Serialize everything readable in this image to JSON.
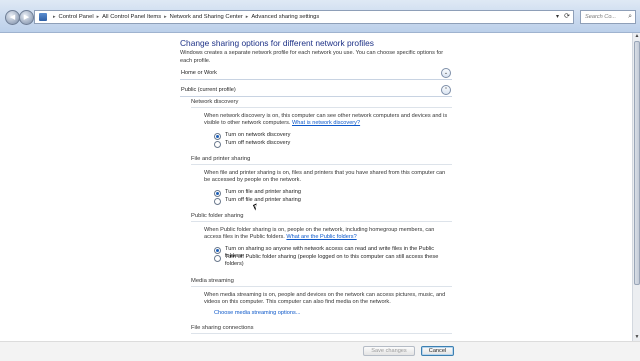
{
  "address_bar": {
    "breadcrumbs": [
      "Control Panel",
      "All Control Panel Items",
      "Network and Sharing Center",
      "Advanced sharing settings"
    ],
    "search_placeholder": "Search Co..."
  },
  "heading": "Change sharing options for different network profiles",
  "intro": "Windows creates a separate network profile for each network you use. You can choose specific options for each profile.",
  "profiles": {
    "home": {
      "label": "Home or Work",
      "expanded": false
    },
    "public": {
      "label": "Public (current profile)",
      "expanded": true
    }
  },
  "network_discovery": {
    "title": "Network discovery",
    "description": "When network discovery is on, this computer can see other network computers and devices and is visible to other network computers.",
    "link": "What is network discovery?",
    "options": [
      "Turn on network discovery",
      "Turn off network discovery"
    ],
    "selected": 0
  },
  "file_printer_sharing": {
    "title": "File and printer sharing",
    "description": "When file and printer sharing is on, files and printers that you have shared from this computer can be accessed by people on the network.",
    "options": [
      "Turn on file and printer sharing",
      "Turn off file and printer sharing"
    ],
    "selected": 0
  },
  "public_folder_sharing": {
    "title": "Public folder sharing",
    "description": "When Public folder sharing is on, people on the network, including homegroup members, can access files in the Public folders.",
    "link": "What are the Public folders?",
    "options": [
      "Turn on sharing so anyone with network access can read and write files in the Public folders",
      "Turn off Public folder sharing (people logged on to this computer can still access these folders)"
    ],
    "selected": 0
  },
  "media_streaming": {
    "title": "Media streaming",
    "description": "When media streaming is on, people and devices on the network can access pictures, music, and videos on this computer. This computer can also find media on the network.",
    "link": "Choose media streaming options..."
  },
  "file_sharing_connections": {
    "title": "File sharing connections"
  },
  "footer": {
    "save_label": "Save changes",
    "cancel_label": "Cancel"
  }
}
